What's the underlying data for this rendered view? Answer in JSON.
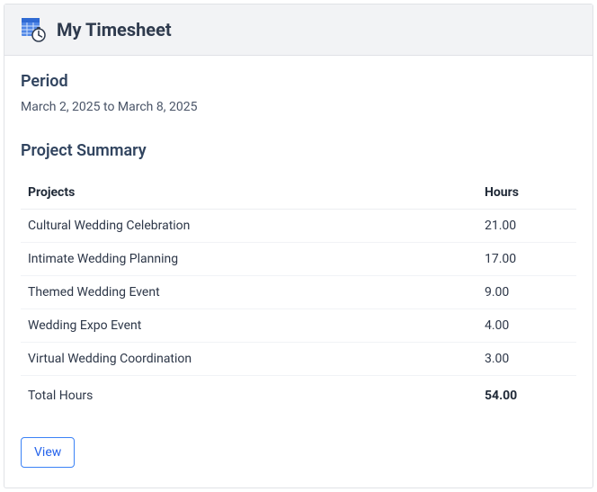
{
  "header": {
    "title": "My Timesheet"
  },
  "period": {
    "label": "Period",
    "value": "March 2, 2025 to March 8, 2025"
  },
  "summary": {
    "title": "Project Summary",
    "columns": {
      "projects": "Projects",
      "hours": "Hours"
    },
    "rows": [
      {
        "project": "Cultural Wedding Celebration",
        "hours": "21.00"
      },
      {
        "project": "Intimate Wedding Planning",
        "hours": "17.00"
      },
      {
        "project": "Themed Wedding Event",
        "hours": "9.00"
      },
      {
        "project": "Wedding Expo Event",
        "hours": "4.00"
      },
      {
        "project": "Virtual Wedding Coordination",
        "hours": "3.00"
      }
    ],
    "total": {
      "label": "Total Hours",
      "value": "54.00"
    }
  },
  "actions": {
    "view": "View"
  }
}
